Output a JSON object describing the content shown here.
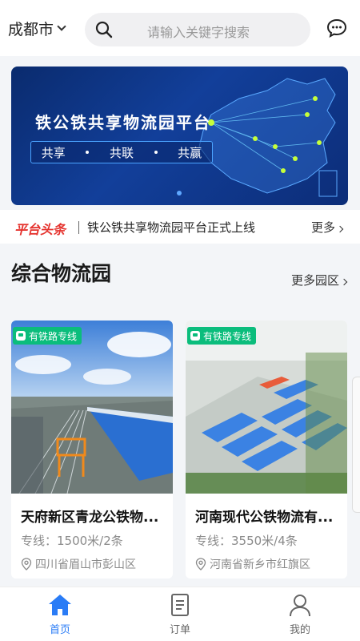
{
  "header": {
    "city": "成都市",
    "search_placeholder": "请输入关键字搜索"
  },
  "banner": {
    "title": "铁公铁共享物流园平台",
    "tags": [
      "共享",
      "共联",
      "共赢"
    ]
  },
  "news": {
    "tag": "平台头条",
    "headline": "铁公铁共享物流园平台正式上线",
    "more": "更多"
  },
  "section": {
    "title": "综合物流园",
    "more": "更多园区"
  },
  "parks": [
    {
      "badge": "有铁路专线",
      "name": "天府新区青龙公铁物...",
      "line": "专线：1500米/2条",
      "location": "四川省眉山市彭山区"
    },
    {
      "badge": "有铁路专线",
      "name": "河南现代公铁物流有...",
      "line": "专线：3550米/4条",
      "location": "河南省新乡市红旗区"
    }
  ],
  "tabbar": {
    "home": "首页",
    "orders": "订单",
    "mine": "我的"
  },
  "colors": {
    "accent": "#2a7cf6",
    "headline_red": "#e5322d",
    "badge_green": "#0bbd7c"
  }
}
